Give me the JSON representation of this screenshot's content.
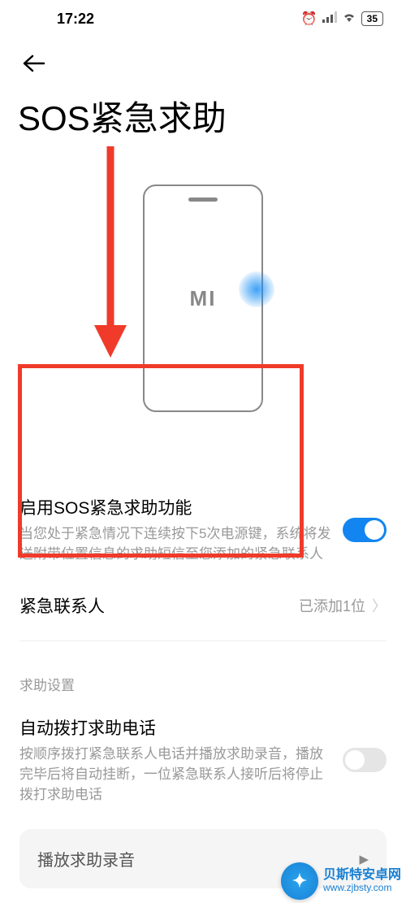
{
  "status": {
    "time": "17:22",
    "battery": "35"
  },
  "page": {
    "title": "SOS紧急求助"
  },
  "phone": {
    "logo": "MI"
  },
  "sos": {
    "title": "启用SOS紧急求助功能",
    "desc": "当您处于紧急情况下连续按下5次电源键，系统将发送附带位置信息的求助短信至您添加的紧急联系人",
    "enabled": true
  },
  "contacts": {
    "title": "紧急联系人",
    "value": "已添加1位"
  },
  "section_label": "求助设置",
  "autodial": {
    "title": "自动拨打求助电话",
    "desc": "按顺序拨打紧急联系人电话并播放求助录音，播放完毕后将自动挂断，一位紧急联系人接听后将停止拨打求助电话",
    "enabled": false
  },
  "play": {
    "label": "播放求助录音"
  },
  "watermark": {
    "title": "贝斯特安卓网",
    "url": "www.zjbsty.com"
  }
}
